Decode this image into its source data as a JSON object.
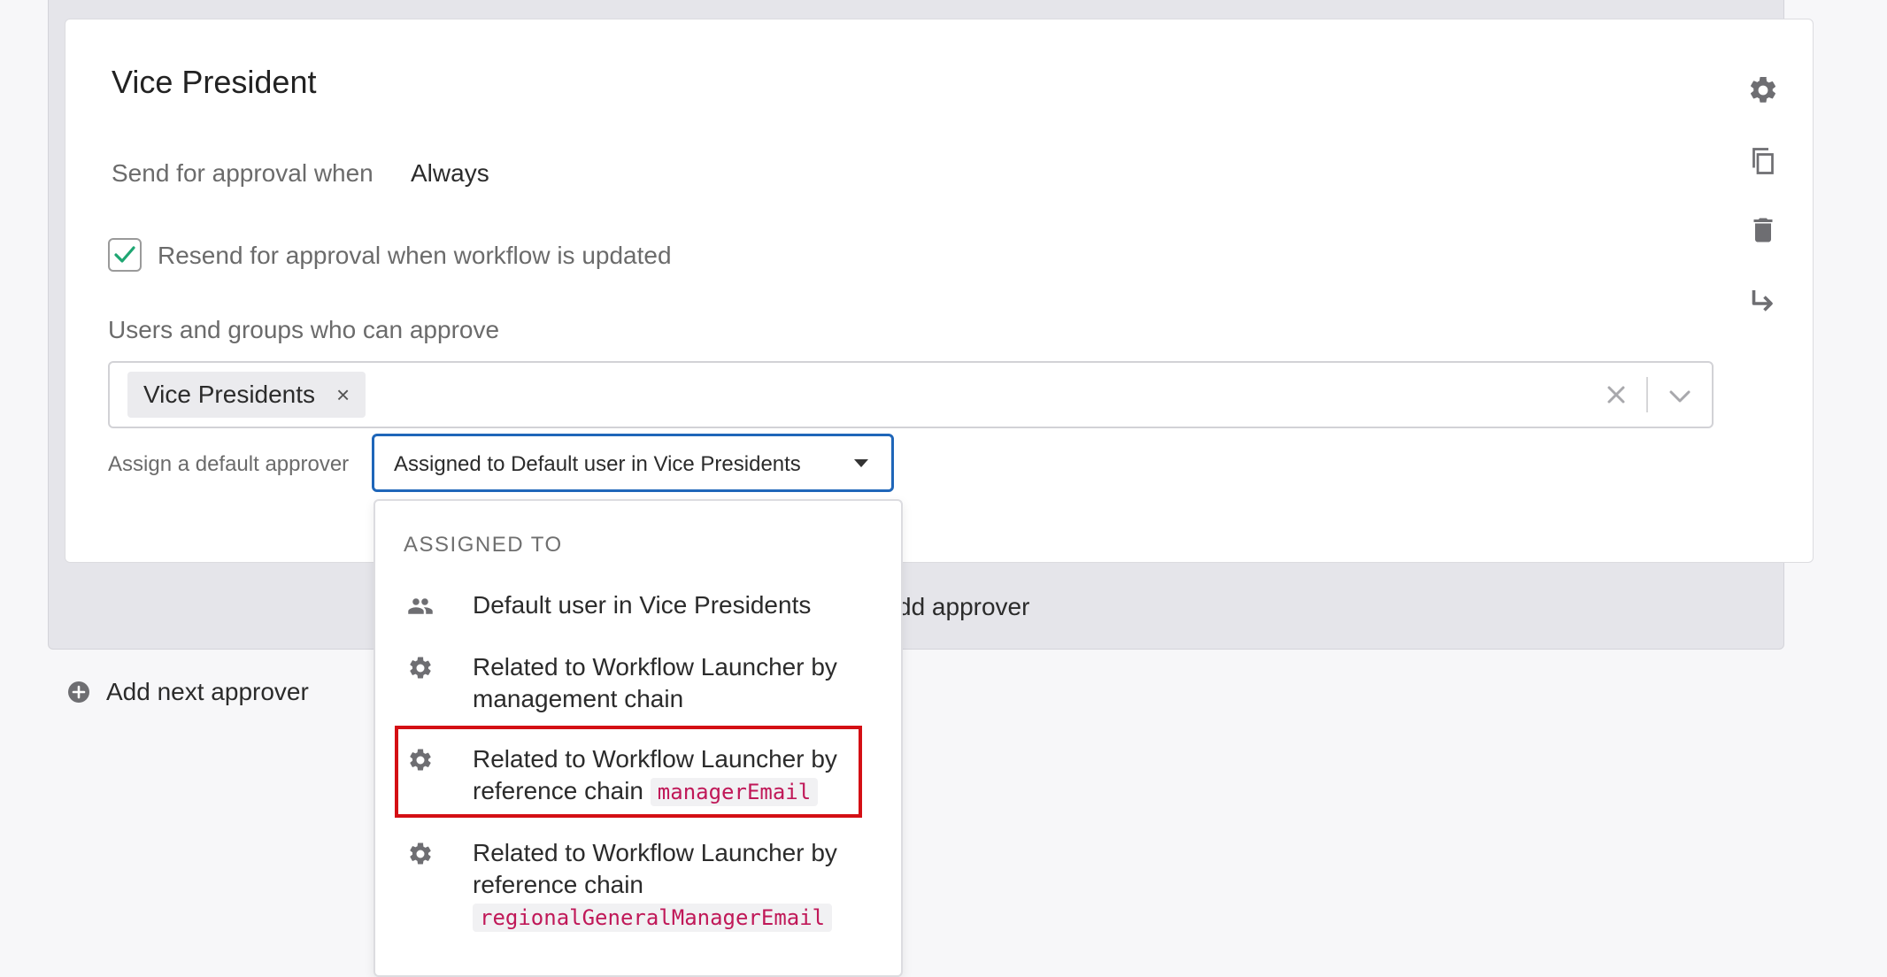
{
  "card": {
    "title": "Vice President",
    "send_for_approval_label": "Send for approval when",
    "send_for_approval_value": "Always",
    "resend_checkbox": {
      "checked": true,
      "label": "Resend for approval when workflow is updated"
    },
    "users_groups_label": "Users and groups who can approve",
    "selected_groups": [
      "Vice Presidents"
    ],
    "chip_remove_glyph": "×",
    "assign_default_label": "Assign a default approver",
    "assign_default_value": "Assigned to Default user in Vice Presidents"
  },
  "side_actions": [
    {
      "icon": "gear-icon"
    },
    {
      "icon": "copy-icon"
    },
    {
      "icon": "trash-icon"
    },
    {
      "icon": "move-down-arrow-icon"
    }
  ],
  "add_approver_partial": "dd approver",
  "add_next_approver_label": "Add next approver",
  "dropdown": {
    "header": "ASSIGNED TO",
    "items": [
      {
        "icon": "users-icon",
        "text": "Default user in Vice Presidents",
        "code": ""
      },
      {
        "icon": "gear-icon",
        "text": "Related to Workflow Launcher by management chain",
        "code": ""
      },
      {
        "icon": "gear-icon",
        "text": "Related to Workflow Launcher by reference chain",
        "code": "managerEmail",
        "highlighted": true
      },
      {
        "icon": "gear-icon",
        "text": "Related to Workflow Launcher by reference chain",
        "code": "regionalGeneralManagerEmail"
      }
    ]
  },
  "colors": {
    "accent_blue": "#1f66b9",
    "checkmark_green": "#1ea672",
    "highlight_red": "#d40f14",
    "code_pink": "#c01858"
  }
}
